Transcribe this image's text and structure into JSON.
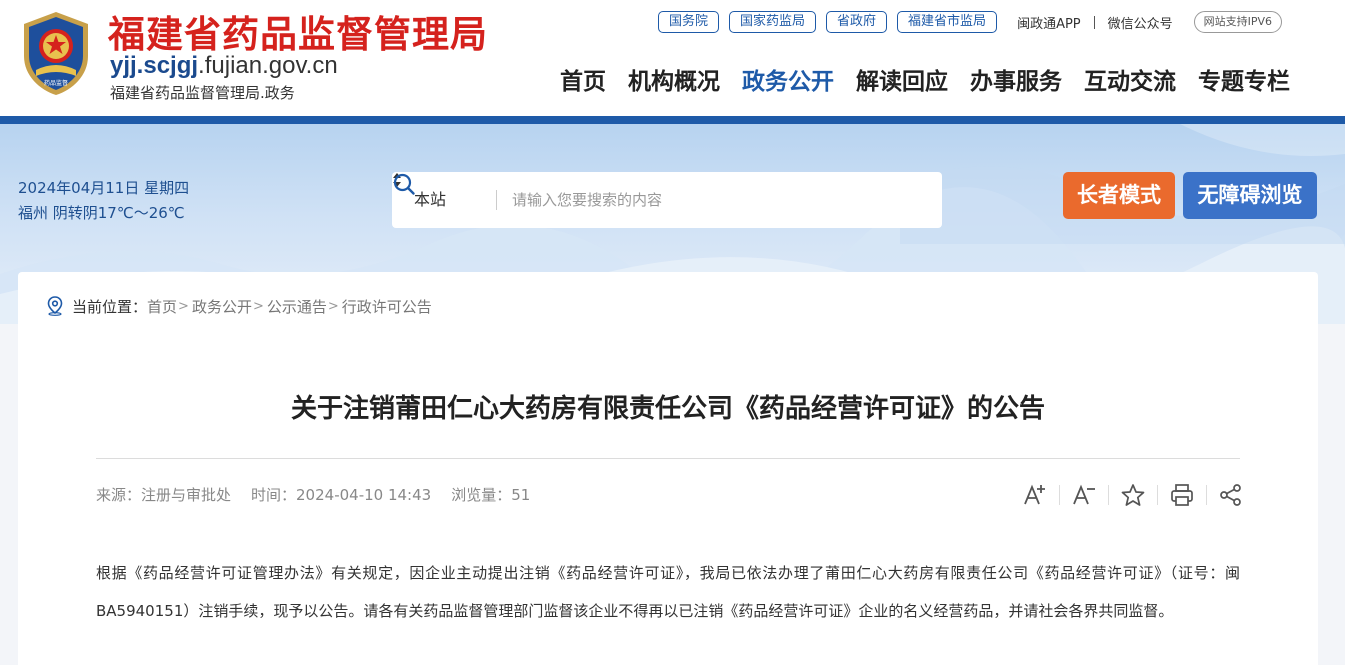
{
  "header": {
    "title": "福建省药品监督管理局",
    "domain_prefix": "yjj.scjgj",
    "domain_suffix": ".fujian.gov.cn",
    "subtitle": "福建省药品监督管理局.政务",
    "emblem_text": "药品监督"
  },
  "toplinks": {
    "pills": [
      "国务院",
      "国家药监局",
      "省政府",
      "福建省市监局"
    ],
    "app": "闽政通APP",
    "wechat": "微信公众号",
    "ipv6": "网站支持IPV6"
  },
  "nav": {
    "items": [
      "首页",
      "机构概况",
      "政务公开",
      "解读回应",
      "办事服务",
      "互动交流",
      "专题专栏"
    ],
    "active": "政务公开"
  },
  "banner": {
    "date": "2024年04月11日 星期四",
    "weather": "福州 阴转阴17℃～26℃",
    "search_scope": "本站",
    "search_placeholder": "请输入您要搜索的内容",
    "elder_mode": "长者模式",
    "accessible": "无障碍浏览"
  },
  "breadcrumb": {
    "label": "当前位置：",
    "items": [
      "首页",
      "政务公开",
      "公示通告",
      "行政许可公告"
    ]
  },
  "article": {
    "title": "关于注销莆田仁心大药房有限责任公司《药品经营许可证》的公告",
    "source": "来源：注册与审批处",
    "time": "时间：2024-04-10 14:43",
    "views": "浏览量：51",
    "body": "根据《药品经营许可证管理办法》有关规定，因企业主动提出注销《药品经营许可证》，我局已依法办理了莆田仁心大药房有限责任公司《药品经营许可证》（证号：闽BA5940151）注销手续，现予以公告。请各有关药品监督管理部门监督该企业不得再以已注销《药品经营许可证》企业的名义经营药品，并请社会各界共同监督。"
  },
  "tools": {
    "font_increase": "A+",
    "font_decrease": "A−"
  },
  "colors": {
    "brand_red": "#d5221d",
    "brand_blue": "#1e5aa8",
    "elder_orange": "#ea6a2d",
    "access_blue": "#3b72c8"
  }
}
